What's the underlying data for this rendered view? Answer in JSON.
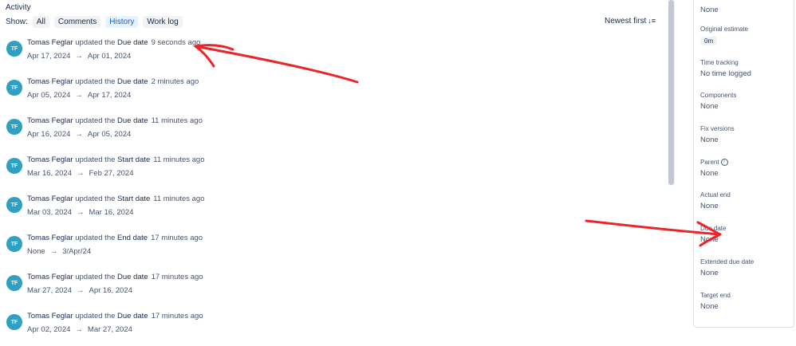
{
  "activity": {
    "title": "Activity",
    "show_label": "Show:",
    "filters": [
      {
        "label": "All",
        "active": false
      },
      {
        "label": "Comments",
        "active": false
      },
      {
        "label": "History",
        "active": true
      },
      {
        "label": "Work log",
        "active": false
      }
    ],
    "sort_label": "Newest first",
    "entries": [
      {
        "initials": "TF",
        "user": "Tomas Feglar",
        "action": "updated the",
        "field": "Due date",
        "time": "9 seconds ago",
        "from": "Apr 17, 2024",
        "to": "Apr 01, 2024"
      },
      {
        "initials": "TF",
        "user": "Tomas Feglar",
        "action": "updated the",
        "field": "Due date",
        "time": "2 minutes ago",
        "from": "Apr 05, 2024",
        "to": "Apr 17, 2024"
      },
      {
        "initials": "TF",
        "user": "Tomas Feglar",
        "action": "updated the",
        "field": "Due date",
        "time": "11 minutes ago",
        "from": "Apr 16, 2024",
        "to": "Apr 05, 2024"
      },
      {
        "initials": "TF",
        "user": "Tomas Feglar",
        "action": "updated the",
        "field": "Start date",
        "time": "11 minutes ago",
        "from": "Mar 16, 2024",
        "to": "Feb 27, 2024"
      },
      {
        "initials": "TF",
        "user": "Tomas Feglar",
        "action": "updated the",
        "field": "Start date",
        "time": "11 minutes ago",
        "from": "Mar 03, 2024",
        "to": "Mar 16, 2024"
      },
      {
        "initials": "TF",
        "user": "Tomas Feglar",
        "action": "updated the",
        "field": "End date",
        "time": "17 minutes ago",
        "from": "None",
        "to": "3/Apr/24"
      },
      {
        "initials": "TF",
        "user": "Tomas Feglar",
        "action": "updated the",
        "field": "Due date",
        "time": "17 minutes ago",
        "from": "Mar 27, 2024",
        "to": "Apr 16, 2024"
      },
      {
        "initials": "TF",
        "user": "Tomas Feglar",
        "action": "updated the",
        "field": "Due date",
        "time": "17 minutes ago",
        "from": "Apr 02, 2024",
        "to": "Mar 27, 2024"
      }
    ]
  },
  "details": {
    "fields": [
      {
        "label": "",
        "value": "None",
        "lozenge": false
      },
      {
        "label": "Original estimate",
        "value": "0m",
        "lozenge": true
      },
      {
        "label": "Time tracking",
        "value": "No time logged",
        "lozenge": false
      },
      {
        "label": "Components",
        "value": "None",
        "lozenge": false
      },
      {
        "label": "Fix versions",
        "value": "None",
        "lozenge": false
      },
      {
        "label": "Parent",
        "value": "None",
        "lozenge": false,
        "info_icon": true
      },
      {
        "label": "Actual end",
        "value": "None",
        "lozenge": false
      },
      {
        "label": "Due date",
        "value": "None",
        "lozenge": false
      },
      {
        "label": "Extended due date",
        "value": "None",
        "lozenge": false
      },
      {
        "label": "Target end",
        "value": "None",
        "lozenge": false
      }
    ]
  },
  "annotation_color": "#e8262a",
  "arrow_symbol": "→",
  "sort_icon": "sort-descending-icon"
}
